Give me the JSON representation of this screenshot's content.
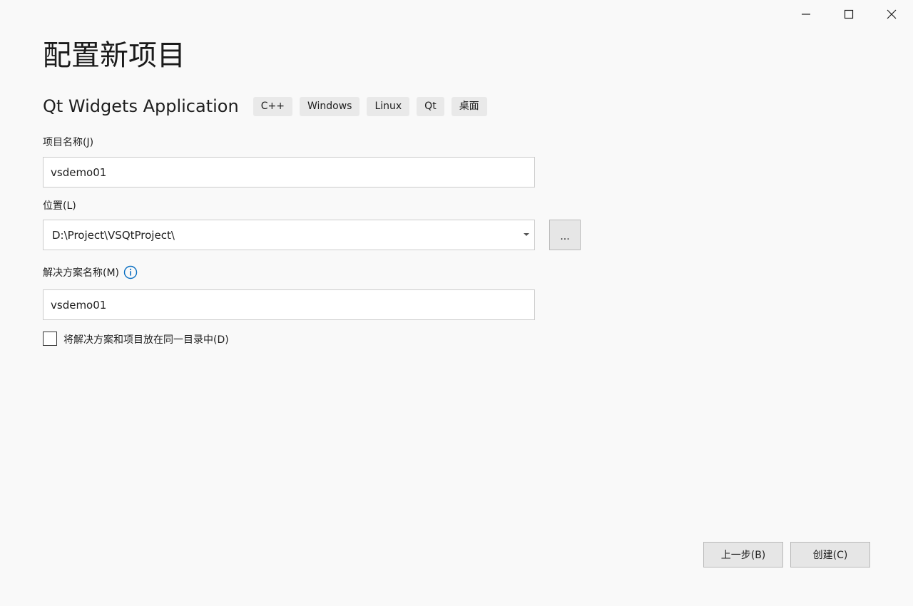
{
  "window": {
    "controls": [
      {
        "name": "minimize-icon"
      },
      {
        "name": "maximize-icon"
      },
      {
        "name": "close-icon"
      }
    ]
  },
  "page": {
    "title": "配置新项目"
  },
  "template": {
    "name": "Qt Widgets Application",
    "tags": [
      "C++",
      "Windows",
      "Linux",
      "Qt",
      "桌面"
    ]
  },
  "form": {
    "project_name": {
      "label": "项目名称(J)",
      "value": "vsdemo01"
    },
    "location": {
      "label": "位置(L)",
      "value": "D:\\Project\\VSQtProject\\",
      "browse_label": "..."
    },
    "solution_name": {
      "label": "解决方案名称(M)",
      "info_icon": "info-icon",
      "value": "vsdemo01"
    },
    "same_dir": {
      "label": "将解决方案和项目放在同一目录中(D)",
      "checked": false
    }
  },
  "footer": {
    "back_label": "上一步(B)",
    "create_label": "创建(C)"
  },
  "colors": {
    "background": "#f9f9f9",
    "info_accent": "#0a6fc2",
    "button_bg": "#e6e6e6"
  }
}
